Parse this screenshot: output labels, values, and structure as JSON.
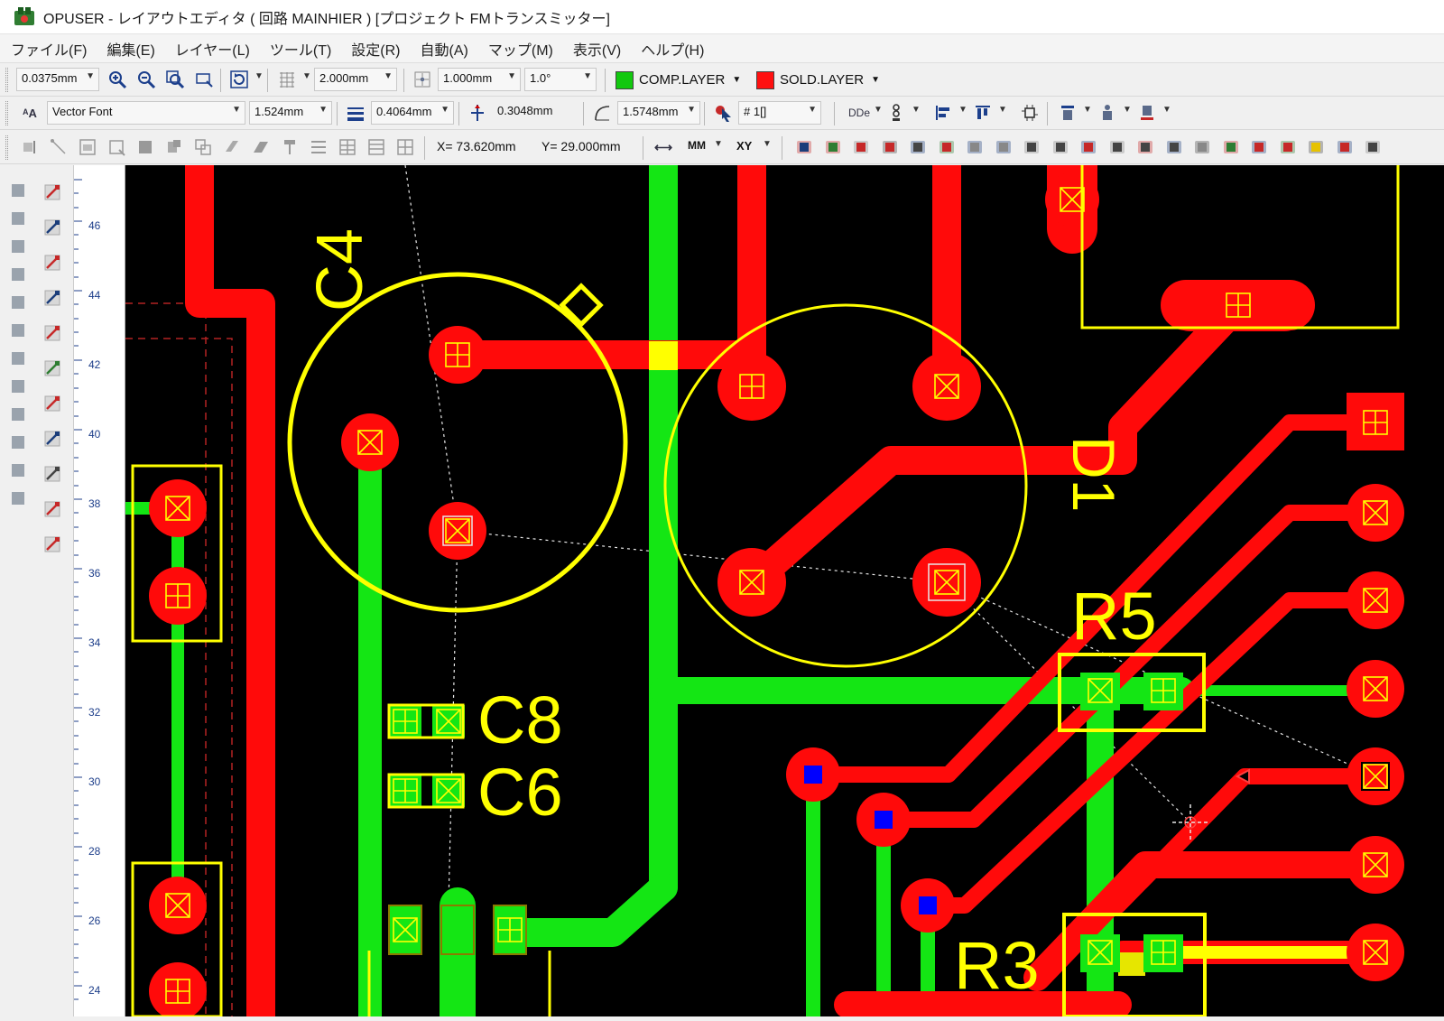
{
  "window": {
    "title": "OPUSER - レイアウトエディタ ( 回路 MAINHIER ) [プロジェクト FMトランスミッター]"
  },
  "menu": [
    "ファイル(F)",
    "編集(E)",
    "レイヤー(L)",
    "ツール(T)",
    "設定(R)",
    "自動(A)",
    "マップ(M)",
    "表示(V)",
    "ヘルプ(H)"
  ],
  "toolbar1": {
    "zoom_value": "0.0375mm",
    "grid_value": "2.000mm",
    "snap_value": "1.000mm",
    "angle_value": "1.0°",
    "comp_layer": "COMP.LAYER",
    "sold_layer": "SOLD.LAYER"
  },
  "toolbar2": {
    "font_name": "Vector Font",
    "text_height": "1.524mm",
    "line_width": "0.4064mm",
    "pad_size": "0.3048mm",
    "arc_width": "1.5748mm",
    "net_value": "# 1[]",
    "via_label": "DDe"
  },
  "toolbar3": {
    "x_coord": "X= 73.620mm",
    "y_coord": "Y= 29.000mm",
    "unit": "MM",
    "coord_mode": "XY"
  },
  "ruler": {
    "labels": [
      "46",
      "44",
      "42",
      "40",
      "38",
      "36",
      "34",
      "32",
      "30",
      "28",
      "26",
      "24"
    ]
  },
  "silkscreen": {
    "c4": "C4",
    "d1": "D1",
    "c8": "C8",
    "c6": "C6",
    "r5": "R5",
    "r3": "R3"
  },
  "colors": {
    "comp_layer": "#00e600",
    "sold_layer": "#ff0000",
    "silk": "#ffff00",
    "via": "#0000ff",
    "ratsnest": "#ffffff",
    "background": "#000000"
  }
}
